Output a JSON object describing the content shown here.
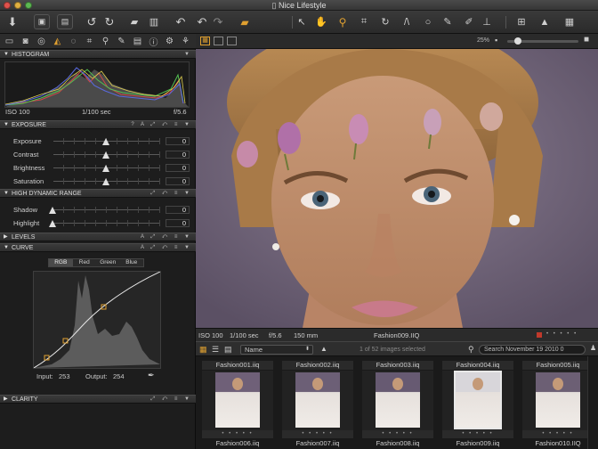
{
  "window": {
    "title": "Nice Lifestyle"
  },
  "toolbar": {
    "zoom_percent": "25%"
  },
  "sections": {
    "histogram": "HISTOGRAM",
    "exposure": "EXPOSURE",
    "hdr": "HIGH DYNAMIC RANGE",
    "levels": "LEVELS",
    "curve": "CURVE",
    "clarity": "CLARITY"
  },
  "histogram": {
    "iso": "ISO 100",
    "shutter": "1/100 sec",
    "aperture": "f/5.6"
  },
  "exposure": [
    {
      "label": "Exposure",
      "value": "0"
    },
    {
      "label": "Contrast",
      "value": "0"
    },
    {
      "label": "Brightness",
      "value": "0"
    },
    {
      "label": "Saturation",
      "value": "0"
    }
  ],
  "hdr": [
    {
      "label": "Shadow",
      "value": "0"
    },
    {
      "label": "Highlight",
      "value": "0"
    }
  ],
  "curve": {
    "tabs": [
      "RGB",
      "Red",
      "Green",
      "Blue"
    ],
    "active_tab": "RGB",
    "input_label": "Input:",
    "input_value": "253",
    "output_label": "Output:",
    "output_value": "254"
  },
  "viewer_info": {
    "iso": "ISO 100",
    "shutter": "1/100 sec",
    "aperture": "f/5.6",
    "focal": "150 mm",
    "filename": "Fashion009.IIQ"
  },
  "browser": {
    "sort_label": "Name",
    "selection_text": "1 of 52 images selected",
    "search_placeholder": "Search November 19 2010 0",
    "top_labels": [
      "Fashion001.iiq",
      "Fashion002.iiq",
      "Fashion003.iiq",
      "Fashion004.iiq",
      "Fashion005.iiq"
    ],
    "bottom_labels": [
      "Fashion006.iiq",
      "Fashion007.iiq",
      "Fashion008.iiq",
      "Fashion009.iiq",
      "Fashion010.IIQ"
    ]
  },
  "colors": {
    "accent": "#e0a030",
    "viewer_bg": "#6a5f73",
    "selection_red": "#c0392b"
  }
}
